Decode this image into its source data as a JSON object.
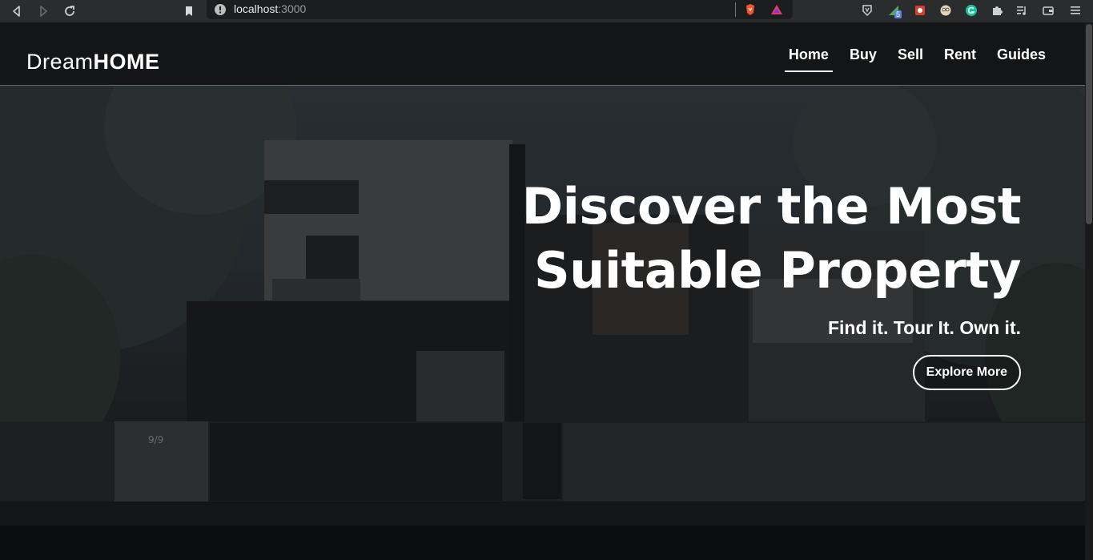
{
  "browser": {
    "url_host": "localhost",
    "url_port": ":3000",
    "extension_badge": "5"
  },
  "brand": {
    "light": "Dream",
    "bold": "HOME"
  },
  "nav": {
    "items": [
      {
        "label": "Home",
        "active": true
      },
      {
        "label": "Buy"
      },
      {
        "label": "Sell"
      },
      {
        "label": "Rent"
      },
      {
        "label": "Guides"
      }
    ]
  },
  "hero": {
    "headline_line1": "Discover the Most",
    "headline_line2": "Suitable Property",
    "subheadline": "Find it. Tour It. Own it.",
    "cta_label": "Explore More",
    "gate_number": "9/9"
  },
  "colors": {
    "navbar_bg": "#141516",
    "text": "#ffffff",
    "chrome_bg": "#2b2c2e"
  }
}
